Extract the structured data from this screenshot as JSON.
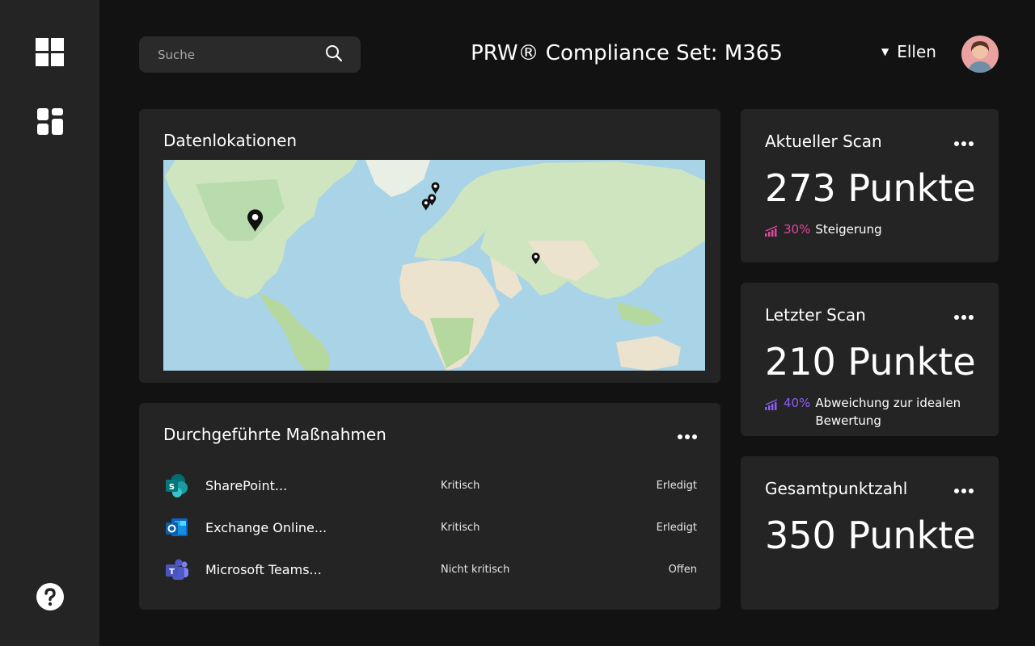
{
  "search": {
    "placeholder": "Suche"
  },
  "header": {
    "title": "PRW® Compliance Set: M365",
    "user_name": "Ellen"
  },
  "map_card": {
    "title": "Datenlokationen",
    "markers": [
      {
        "lat": 38.5,
        "lon": -109
      },
      {
        "lat": 59.3,
        "lon": 10.8
      },
      {
        "lat": 52.8,
        "lon": 8.5
      },
      {
        "lat": 50.1,
        "lon": 4.5
      },
      {
        "lat": 20.5,
        "lon": 77.5
      }
    ]
  },
  "actions_card": {
    "title": "Durchgeführte Maßnahmen",
    "rows": [
      {
        "icon": "sharepoint-icon",
        "name": "SharePoint...",
        "priority": "Kritisch",
        "status": "Erledigt"
      },
      {
        "icon": "outlook-icon",
        "name": "Exchange Online...",
        "priority": "Kritisch",
        "status": "Erledigt"
      },
      {
        "icon": "teams-icon",
        "name": "Microsoft Teams...",
        "priority": "Nicht kritisch",
        "status": "Offen"
      }
    ]
  },
  "current_scan": {
    "title": "Aktueller Scan",
    "value": "273 Punkte",
    "percent": "30%",
    "text": "Steigerung",
    "color": "#e0479e"
  },
  "last_scan": {
    "title": "Letzter Scan",
    "value": "210 Punkte",
    "percent": "40%",
    "text": "Abweichung zur idealen Bewertung",
    "color": "#8b5cf6"
  },
  "total_score": {
    "title": "Gesamtpunktzahl",
    "value": "350 Punkte"
  }
}
